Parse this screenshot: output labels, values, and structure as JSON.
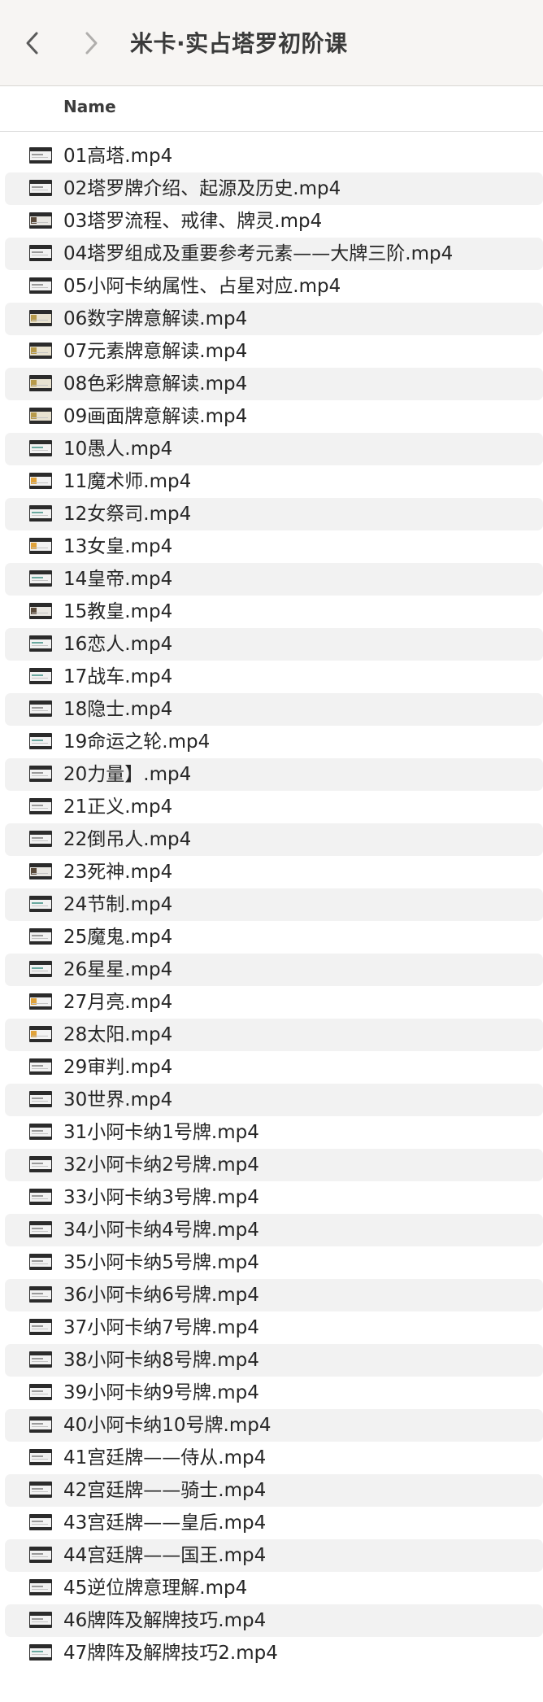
{
  "window": {
    "title": "米卡·实占塔罗初阶课",
    "back_icon": "chevron-left-icon",
    "forward_icon": "chevron-right-icon"
  },
  "columns": {
    "name": "Name"
  },
  "files": [
    {
      "name": "01高塔.mp4",
      "thumb": "plain"
    },
    {
      "name": "02塔罗牌介绍、起源及历史.mp4",
      "thumb": "plain"
    },
    {
      "name": "03塔罗流程、戒律、牌灵.mp4",
      "thumb": "dark"
    },
    {
      "name": "04塔罗组成及重要参考元素——大牌三阶.mp4",
      "thumb": "plain"
    },
    {
      "name": "05小阿卡纳属性、占星对应.mp4",
      "thumb": "plain"
    },
    {
      "name": "06数字牌意解读.mp4",
      "thumb": "color"
    },
    {
      "name": "07元素牌意解读.mp4",
      "thumb": "color"
    },
    {
      "name": "08色彩牌意解读.mp4",
      "thumb": "color"
    },
    {
      "name": "09画面牌意解读.mp4",
      "thumb": "color"
    },
    {
      "name": "10愚人.mp4",
      "thumb": "teal"
    },
    {
      "name": "11魔术师.mp4",
      "thumb": "orange"
    },
    {
      "name": "12女祭司.mp4",
      "thumb": "teal"
    },
    {
      "name": "13女皇.mp4",
      "thumb": "orange"
    },
    {
      "name": "14皇帝.mp4",
      "thumb": "teal"
    },
    {
      "name": "15教皇.mp4",
      "thumb": "dark"
    },
    {
      "name": "16恋人.mp4",
      "thumb": "teal"
    },
    {
      "name": "17战车.mp4",
      "thumb": "teal"
    },
    {
      "name": "18隐士.mp4",
      "thumb": "plain"
    },
    {
      "name": "19命运之轮.mp4",
      "thumb": "teal"
    },
    {
      "name": "20力量】.mp4",
      "thumb": "plain"
    },
    {
      "name": "21正义.mp4",
      "thumb": "plain"
    },
    {
      "name": "22倒吊人.mp4",
      "thumb": "plain"
    },
    {
      "name": "23死神.mp4",
      "thumb": "dark"
    },
    {
      "name": "24节制.mp4",
      "thumb": "teal"
    },
    {
      "name": "25魔鬼.mp4",
      "thumb": "plain"
    },
    {
      "name": "26星星.mp4",
      "thumb": "teal"
    },
    {
      "name": "27月亮.mp4",
      "thumb": "orange"
    },
    {
      "name": "28太阳.mp4",
      "thumb": "orange"
    },
    {
      "name": "29审判.mp4",
      "thumb": "plain"
    },
    {
      "name": "30世界.mp4",
      "thumb": "plain"
    },
    {
      "name": "31小阿卡纳1号牌.mp4",
      "thumb": "plain"
    },
    {
      "name": "32小阿卡纳2号牌.mp4",
      "thumb": "plain"
    },
    {
      "name": "33小阿卡纳3号牌.mp4",
      "thumb": "plain"
    },
    {
      "name": "34小阿卡纳4号牌.mp4",
      "thumb": "plain"
    },
    {
      "name": "35小阿卡纳5号牌.mp4",
      "thumb": "plain"
    },
    {
      "name": "36小阿卡纳6号牌.mp4",
      "thumb": "plain"
    },
    {
      "name": "37小阿卡纳7号牌.mp4",
      "thumb": "plain"
    },
    {
      "name": "38小阿卡纳8号牌.mp4",
      "thumb": "plain"
    },
    {
      "name": "39小阿卡纳9号牌.mp4",
      "thumb": "plain"
    },
    {
      "name": "40小阿卡纳10号牌.mp4",
      "thumb": "plain"
    },
    {
      "name": "41宫廷牌——侍从.mp4",
      "thumb": "plain"
    },
    {
      "name": "42宫廷牌——骑士.mp4",
      "thumb": "plain"
    },
    {
      "name": "43宫廷牌——皇后.mp4",
      "thumb": "plain"
    },
    {
      "name": "44宫廷牌——国王.mp4",
      "thumb": "plain"
    },
    {
      "name": "45逆位牌意理解.mp4",
      "thumb": "plain"
    },
    {
      "name": "46牌阵及解牌技巧.mp4",
      "thumb": "plain"
    },
    {
      "name": "47牌阵及解牌技巧2.mp4",
      "thumb": "teal"
    }
  ]
}
